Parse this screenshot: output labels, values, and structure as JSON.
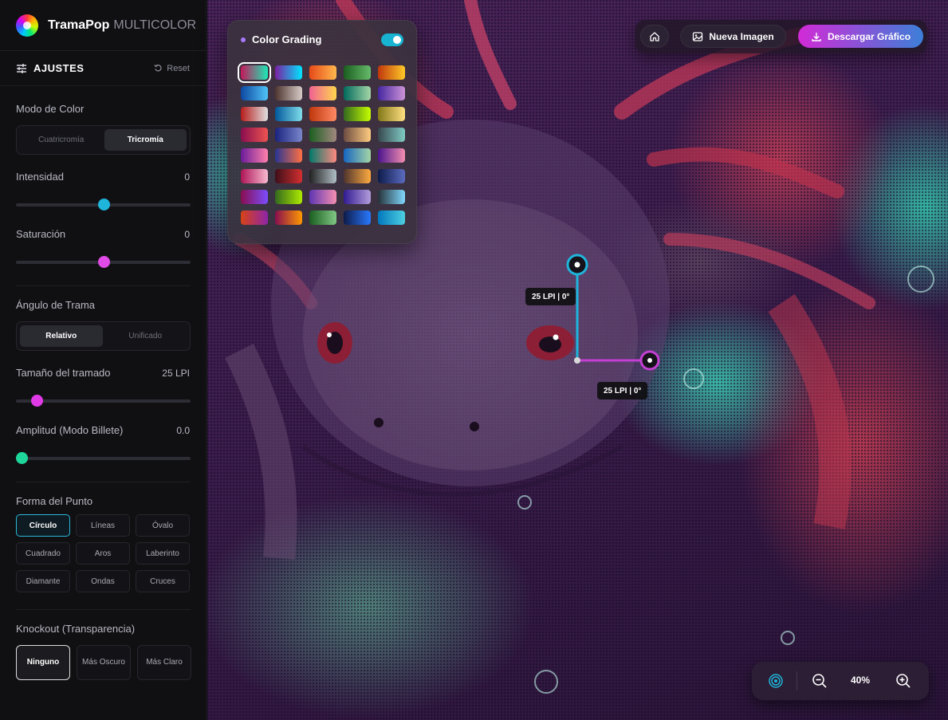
{
  "app": {
    "brand": "TramaPop",
    "brand_sub": "MULTICOLOR"
  },
  "sidebar": {
    "section_title": "AJUSTES",
    "reset_label": "Reset",
    "color_mode": {
      "label": "Modo de Color",
      "options": [
        "Cuatricromía",
        "Tricromía"
      ],
      "selected": "Tricromía"
    },
    "intensity": {
      "label": "Intensidad",
      "value": "0",
      "level": 0.5,
      "color": "#1fb5db"
    },
    "saturation": {
      "label": "Saturación",
      "value": "0",
      "level": 0.5,
      "color": "#e04ae6"
    },
    "screen_angle": {
      "label": "Ángulo de Trama",
      "options": [
        "Relativo",
        "Unificado"
      ],
      "selected": "Relativo"
    },
    "screen_size": {
      "label": "Tamaño del tramado",
      "value": "25 LPI",
      "level": 0.12,
      "color": "#e03ae6"
    },
    "amplitude": {
      "label": "Amplitud (Modo Billete)",
      "value": "0.0",
      "level": 0.0,
      "color": "#1fd69a"
    },
    "dot_shape": {
      "label": "Forma del Punto",
      "options": [
        "Círculo",
        "Líneas",
        "Óvalo",
        "Cuadrado",
        "Aros",
        "Laberinto",
        "Diamante",
        "Ondas",
        "Cruces"
      ],
      "selected": "Círculo"
    },
    "knockout": {
      "label": "Knockout (Transparencia)",
      "options": [
        "Ninguno",
        "Más Oscuro",
        "Más Claro"
      ],
      "selected": "Ninguno"
    }
  },
  "color_grading": {
    "title": "Color Grading",
    "enabled": true,
    "swatches": [
      [
        "#c2185b",
        "#1de9b6"
      ],
      [
        "#7b1fa2",
        "#00e5ff"
      ],
      [
        "#e64a19",
        "#ffb74d"
      ],
      [
        "#1b5e20",
        "#66bb6a"
      ],
      [
        "#bf360c",
        "#ffca28"
      ],
      [
        "#0d47a1",
        "#4fc3f7"
      ],
      [
        "#4e342e",
        "#d7ccc8"
      ],
      [
        "#f06292",
        "#ffd54f"
      ],
      [
        "#00695c",
        "#a5d6a7"
      ],
      [
        "#4527a0",
        "#ce93d8"
      ],
      [
        "#b71c1c",
        "#e0e0e0"
      ],
      [
        "#01579b",
        "#80deea"
      ],
      [
        "#bf360c",
        "#ff8a65"
      ],
      [
        "#33691e",
        "#c6ff00"
      ],
      [
        "#827717",
        "#ffe082"
      ],
      [
        "#880e4f",
        "#ef5350"
      ],
      [
        "#1a237e",
        "#7986cb"
      ],
      [
        "#1b5e20",
        "#a1887f"
      ],
      [
        "#6d4c41",
        "#ffcc80"
      ],
      [
        "#37474f",
        "#80cbc4"
      ],
      [
        "#6a1b9a",
        "#ff80ab"
      ],
      [
        "#283593",
        "#ff7043"
      ],
      [
        "#00796b",
        "#ff8a80"
      ],
      [
        "#1565c0",
        "#a5d6a7"
      ],
      [
        "#4a148c",
        "#f48fb1"
      ],
      [
        "#ad1457",
        "#f8bbd0"
      ],
      [
        "#3e0f1a",
        "#d32f2f"
      ],
      [
        "#212121",
        "#b0bec5"
      ],
      [
        "#4e342e",
        "#ffab40"
      ],
      [
        "#0d1b4a",
        "#5c6bc0"
      ],
      [
        "#880e4f",
        "#7c4dff"
      ],
      [
        "#33691e",
        "#aeea00"
      ],
      [
        "#5e35b1",
        "#f48fb1"
      ],
      [
        "#311b92",
        "#b39ddb"
      ],
      [
        "#263238",
        "#80d8ff"
      ],
      [
        "#d84315",
        "#8e24aa"
      ],
      [
        "#880e4f",
        "#ff9800"
      ],
      [
        "#1b5e20",
        "#81c784"
      ],
      [
        "#0d1b4a",
        "#2979ff"
      ],
      [
        "#0277bd",
        "#4dd0e1"
      ]
    ],
    "selected_index": 0
  },
  "topbar": {
    "home_icon": "home-icon",
    "new_label": "Nueva Imagen",
    "download_label": "Descargar Gráfico"
  },
  "zoom": {
    "value": "40%"
  },
  "canvas": {
    "lpi_tag_1": "25 LPI | 0°",
    "lpi_tag_2": "25 LPI | 0°"
  }
}
